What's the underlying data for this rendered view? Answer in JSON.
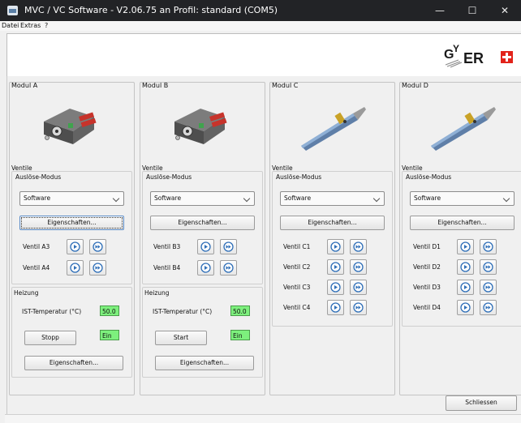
{
  "window": {
    "title": "MVC / VC Software - V2.06.75 an Profil: standard (COM5)",
    "minimize": "—",
    "maximize": "☐",
    "close": "✕"
  },
  "menu": {
    "file": "Datei",
    "extras": "Extras",
    "help": "?"
  },
  "logo": {
    "text": "GEYGER",
    "accent_color": "#e2231a"
  },
  "modules": [
    {
      "title": "Modul A",
      "ventile_label": "Ventile",
      "modus_label": "Auslöse-Modus",
      "modus_value": "Software",
      "eigenschaften": "Eigenschaften...",
      "valves": [
        "Ventil A3",
        "Ventil A4"
      ],
      "heizung": {
        "label": "Heizung",
        "temp_label": "IST-Temperatur (°C)",
        "temp_value": "50.0",
        "button": "Stopp",
        "state": "Ein",
        "eigenschaften": "Eigenschaften..."
      }
    },
    {
      "title": "Modul B",
      "ventile_label": "Ventile",
      "modus_label": "Auslöse-Modus",
      "modus_value": "Software",
      "eigenschaften": "Eigenschaften...",
      "valves": [
        "Ventil B3",
        "Ventil B4"
      ],
      "heizung": {
        "label": "Heizung",
        "temp_label": "IST-Temperatur (°C)",
        "temp_value": "50.0",
        "button": "Start",
        "state": "Ein",
        "eigenschaften": "Eigenschaften..."
      }
    },
    {
      "title": "Modul C",
      "ventile_label": "Ventile",
      "modus_label": "Auslöse-Modus",
      "modus_value": "Software",
      "eigenschaften": "Eigenschaften...",
      "valves": [
        "Ventil C1",
        "Ventil C2",
        "Ventil C3",
        "Ventil C4"
      ]
    },
    {
      "title": "Modul D",
      "ventile_label": "Ventile",
      "modus_label": "Auslöse-Modus",
      "modus_value": "Software",
      "eigenschaften": "Eigenschaften...",
      "valves": [
        "Ventil D1",
        "Ventil D2",
        "Ventil D3",
        "Ventil D4"
      ]
    }
  ],
  "footer": {
    "close_button": "Schliessen"
  },
  "colors": {
    "titlebar": "#222326",
    "indicator_green": "#7df07d",
    "icon_blue": "#2f6fb8"
  }
}
